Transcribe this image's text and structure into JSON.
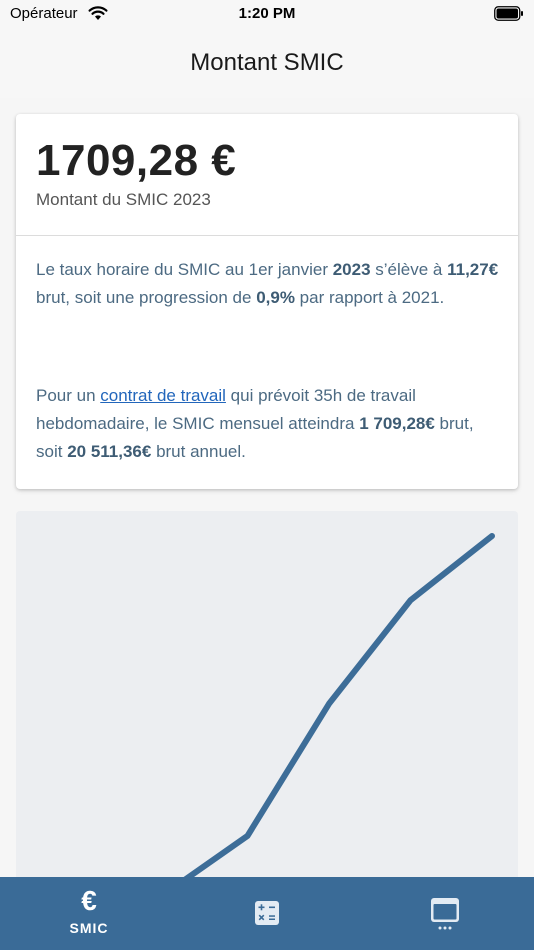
{
  "status_bar": {
    "carrier": "Opérateur",
    "time": "1:20 PM"
  },
  "nav": {
    "title": "Montant SMIC"
  },
  "card": {
    "amount": "1709,28 €",
    "caption": "Montant du SMIC 2023",
    "para1": {
      "t1": "Le taux horaire du SMIC au 1er janvier ",
      "b1": "2023",
      "t2": " s’élève à ",
      "b2": "11,27€",
      "t3": " brut, soit une progression de ",
      "b3": "0,9%",
      "t4": " par rapport à 2021."
    },
    "para2": {
      "t1": "Pour un ",
      "link": "contrat de travail",
      "t2": " qui prévoit 35h de travail hebdomadaire, le SMIC mensuel atteindra ",
      "b1": "1 709,28€",
      "t3": " brut, soit ",
      "b2": "20 511,36€",
      "t4": " brut annuel."
    }
  },
  "chart_data": {
    "type": "line",
    "line_color": "#3d6d98",
    "background": "#eceef1",
    "y_relative": [
      0.0,
      0.16,
      0.53,
      0.82,
      1.0
    ]
  },
  "tab_bar": {
    "background": "#3a6b97",
    "tabs": [
      {
        "icon": "euro-icon",
        "label": "SMIC",
        "selected": true
      },
      {
        "icon": "calculator-icon",
        "label": ""
      },
      {
        "icon": "more-icon",
        "label": ""
      }
    ],
    "euro_symbol": "€"
  }
}
